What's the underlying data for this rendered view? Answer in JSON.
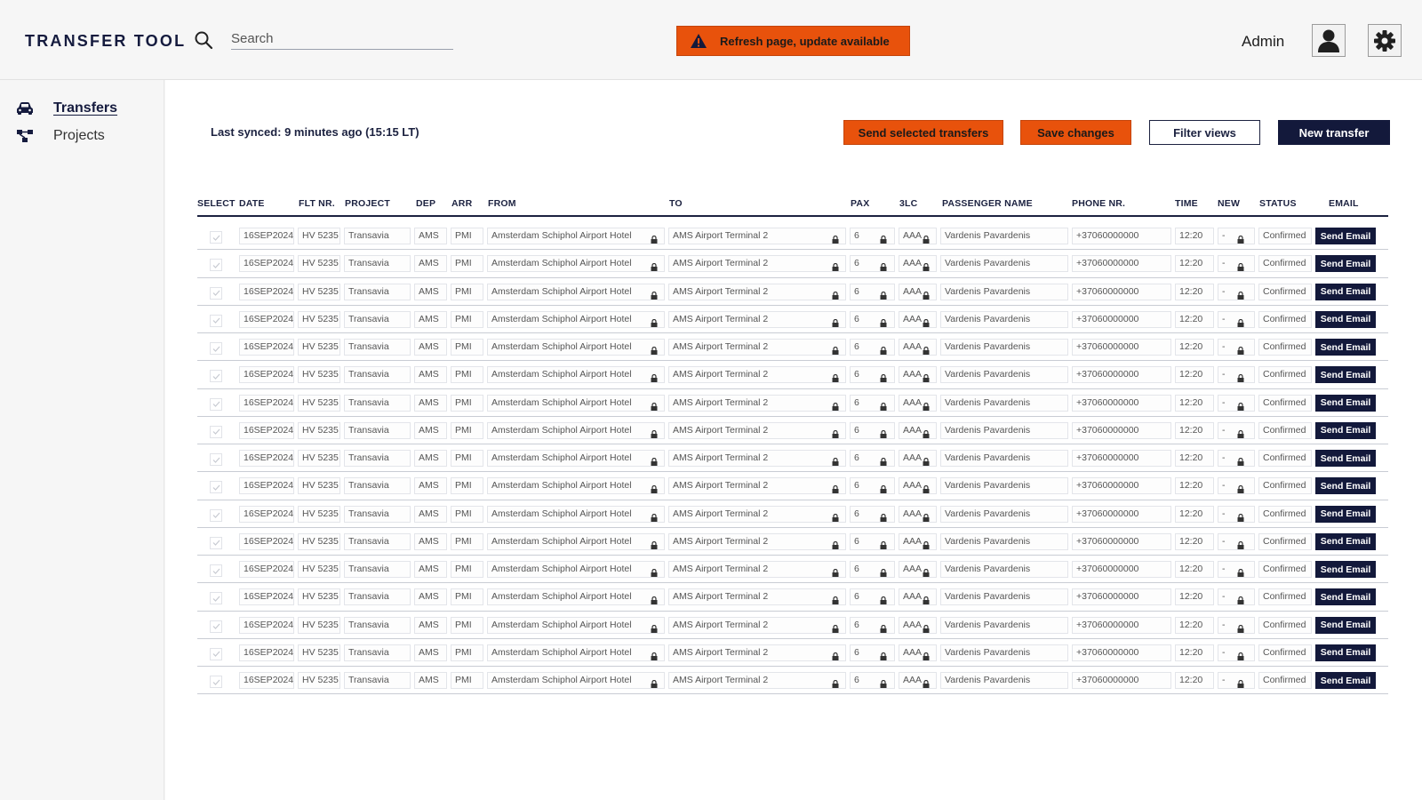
{
  "app": {
    "title": "TRANSFER TOOL",
    "accent": "#e8520c",
    "navy": "#13193b"
  },
  "search": {
    "placeholder": "Search",
    "value": ""
  },
  "alert": {
    "text": "Refresh page, update available",
    "icon": "warning-icon"
  },
  "user": {
    "name": "Admin",
    "avatar_icon": "user-icon",
    "settings_icon": "gear-icon"
  },
  "sidebar": {
    "items": [
      {
        "label": "Transfers",
        "icon": "car-icon",
        "active": true
      },
      {
        "label": "Projects",
        "icon": "projects-icon",
        "active": false
      }
    ]
  },
  "toolbar": {
    "last_synced": "Last synced: 9 minutes ago (15:15 LT)",
    "send_selected": "Send selected transfers",
    "save_changes": "Save changes",
    "filter_views": "Filter views",
    "new_transfer": "New transfer"
  },
  "table": {
    "columns": [
      "SELECT",
      "DATE",
      "FLT NR.",
      "PROJECT",
      "DEP",
      "ARR",
      "FROM",
      "TO",
      "PAX",
      "3LC",
      "PASSENGER NAME",
      "PHONE NR.",
      "TIME",
      "NEW",
      "STATUS",
      "EMAIL"
    ],
    "email_button_label": "Send Email",
    "rows": [
      {
        "date": "16SEP2024",
        "flight": "HV 5235",
        "project": "Transavia",
        "dep": "AMS",
        "arr": "PMI",
        "from": "Amsterdam Schiphol Airport Hotel",
        "to": "AMS Airport Terminal 2",
        "pax": "6",
        "lc": "AAA",
        "passenger": "Vardenis Pavardenis",
        "phone": "+37060000000",
        "time": "12:20",
        "new": "-",
        "status": "Confirmed"
      },
      {
        "date": "16SEP2024",
        "flight": "HV 5235",
        "project": "Transavia",
        "dep": "AMS",
        "arr": "PMI",
        "from": "Amsterdam Schiphol Airport Hotel",
        "to": "AMS Airport Terminal 2",
        "pax": "6",
        "lc": "AAA",
        "passenger": "Vardenis Pavardenis",
        "phone": "+37060000000",
        "time": "12:20",
        "new": "-",
        "status": "Confirmed"
      },
      {
        "date": "16SEP2024",
        "flight": "HV 5235",
        "project": "Transavia",
        "dep": "AMS",
        "arr": "PMI",
        "from": "Amsterdam Schiphol Airport Hotel",
        "to": "AMS Airport Terminal 2",
        "pax": "6",
        "lc": "AAA",
        "passenger": "Vardenis Pavardenis",
        "phone": "+37060000000",
        "time": "12:20",
        "new": "-",
        "status": "Confirmed"
      },
      {
        "date": "16SEP2024",
        "flight": "HV 5235",
        "project": "Transavia",
        "dep": "AMS",
        "arr": "PMI",
        "from": "Amsterdam Schiphol Airport Hotel",
        "to": "AMS Airport Terminal 2",
        "pax": "6",
        "lc": "AAA",
        "passenger": "Vardenis Pavardenis",
        "phone": "+37060000000",
        "time": "12:20",
        "new": "-",
        "status": "Confirmed"
      },
      {
        "date": "16SEP2024",
        "flight": "HV 5235",
        "project": "Transavia",
        "dep": "AMS",
        "arr": "PMI",
        "from": "Amsterdam Schiphol Airport Hotel",
        "to": "AMS Airport Terminal 2",
        "pax": "6",
        "lc": "AAA",
        "passenger": "Vardenis Pavardenis",
        "phone": "+37060000000",
        "time": "12:20",
        "new": "-",
        "status": "Confirmed"
      },
      {
        "date": "16SEP2024",
        "flight": "HV 5235",
        "project": "Transavia",
        "dep": "AMS",
        "arr": "PMI",
        "from": "Amsterdam Schiphol Airport Hotel",
        "to": "AMS Airport Terminal 2",
        "pax": "6",
        "lc": "AAA",
        "passenger": "Vardenis Pavardenis",
        "phone": "+37060000000",
        "time": "12:20",
        "new": "-",
        "status": "Confirmed"
      },
      {
        "date": "16SEP2024",
        "flight": "HV 5235",
        "project": "Transavia",
        "dep": "AMS",
        "arr": "PMI",
        "from": "Amsterdam Schiphol Airport Hotel",
        "to": "AMS Airport Terminal 2",
        "pax": "6",
        "lc": "AAA",
        "passenger": "Vardenis Pavardenis",
        "phone": "+37060000000",
        "time": "12:20",
        "new": "-",
        "status": "Confirmed"
      },
      {
        "date": "16SEP2024",
        "flight": "HV 5235",
        "project": "Transavia",
        "dep": "AMS",
        "arr": "PMI",
        "from": "Amsterdam Schiphol Airport Hotel",
        "to": "AMS Airport Terminal 2",
        "pax": "6",
        "lc": "AAA",
        "passenger": "Vardenis Pavardenis",
        "phone": "+37060000000",
        "time": "12:20",
        "new": "-",
        "status": "Confirmed"
      },
      {
        "date": "16SEP2024",
        "flight": "HV 5235",
        "project": "Transavia",
        "dep": "AMS",
        "arr": "PMI",
        "from": "Amsterdam Schiphol Airport Hotel",
        "to": "AMS Airport Terminal 2",
        "pax": "6",
        "lc": "AAA",
        "passenger": "Vardenis Pavardenis",
        "phone": "+37060000000",
        "time": "12:20",
        "new": "-",
        "status": "Confirmed"
      },
      {
        "date": "16SEP2024",
        "flight": "HV 5235",
        "project": "Transavia",
        "dep": "AMS",
        "arr": "PMI",
        "from": "Amsterdam Schiphol Airport Hotel",
        "to": "AMS Airport Terminal 2",
        "pax": "6",
        "lc": "AAA",
        "passenger": "Vardenis Pavardenis",
        "phone": "+37060000000",
        "time": "12:20",
        "new": "-",
        "status": "Confirmed"
      },
      {
        "date": "16SEP2024",
        "flight": "HV 5235",
        "project": "Transavia",
        "dep": "AMS",
        "arr": "PMI",
        "from": "Amsterdam Schiphol Airport Hotel",
        "to": "AMS Airport Terminal 2",
        "pax": "6",
        "lc": "AAA",
        "passenger": "Vardenis Pavardenis",
        "phone": "+37060000000",
        "time": "12:20",
        "new": "-",
        "status": "Confirmed"
      },
      {
        "date": "16SEP2024",
        "flight": "HV 5235",
        "project": "Transavia",
        "dep": "AMS",
        "arr": "PMI",
        "from": "Amsterdam Schiphol Airport Hotel",
        "to": "AMS Airport Terminal 2",
        "pax": "6",
        "lc": "AAA",
        "passenger": "Vardenis Pavardenis",
        "phone": "+37060000000",
        "time": "12:20",
        "new": "-",
        "status": "Confirmed"
      },
      {
        "date": "16SEP2024",
        "flight": "HV 5235",
        "project": "Transavia",
        "dep": "AMS",
        "arr": "PMI",
        "from": "Amsterdam Schiphol Airport Hotel",
        "to": "AMS Airport Terminal 2",
        "pax": "6",
        "lc": "AAA",
        "passenger": "Vardenis Pavardenis",
        "phone": "+37060000000",
        "time": "12:20",
        "new": "-",
        "status": "Confirmed"
      },
      {
        "date": "16SEP2024",
        "flight": "HV 5235",
        "project": "Transavia",
        "dep": "AMS",
        "arr": "PMI",
        "from": "Amsterdam Schiphol Airport Hotel",
        "to": "AMS Airport Terminal 2",
        "pax": "6",
        "lc": "AAA",
        "passenger": "Vardenis Pavardenis",
        "phone": "+37060000000",
        "time": "12:20",
        "new": "-",
        "status": "Confirmed"
      },
      {
        "date": "16SEP2024",
        "flight": "HV 5235",
        "project": "Transavia",
        "dep": "AMS",
        "arr": "PMI",
        "from": "Amsterdam Schiphol Airport Hotel",
        "to": "AMS Airport Terminal 2",
        "pax": "6",
        "lc": "AAA",
        "passenger": "Vardenis Pavardenis",
        "phone": "+37060000000",
        "time": "12:20",
        "new": "-",
        "status": "Confirmed"
      },
      {
        "date": "16SEP2024",
        "flight": "HV 5235",
        "project": "Transavia",
        "dep": "AMS",
        "arr": "PMI",
        "from": "Amsterdam Schiphol Airport Hotel",
        "to": "AMS Airport Terminal 2",
        "pax": "6",
        "lc": "AAA",
        "passenger": "Vardenis Pavardenis",
        "phone": "+37060000000",
        "time": "12:20",
        "new": "-",
        "status": "Confirmed"
      },
      {
        "date": "16SEP2024",
        "flight": "HV 5235",
        "project": "Transavia",
        "dep": "AMS",
        "arr": "PMI",
        "from": "Amsterdam Schiphol Airport Hotel",
        "to": "AMS Airport Terminal 2",
        "pax": "6",
        "lc": "AAA",
        "passenger": "Vardenis Pavardenis",
        "phone": "+37060000000",
        "time": "12:20",
        "new": "-",
        "status": "Confirmed"
      }
    ]
  }
}
